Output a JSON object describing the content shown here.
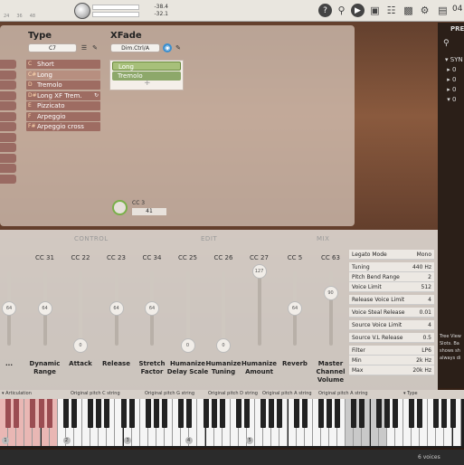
{
  "toolbar": {
    "meter_ticks": [
      "24",
      "36",
      "48"
    ],
    "db_top": "-38.4",
    "db_bottom": "-32.1",
    "icons": [
      "help-icon",
      "location-icon",
      "play-icon",
      "stop-icon",
      "keyboard-icon",
      "chip-icon",
      "gear-icon",
      "folder-icon"
    ],
    "folder_number": "04"
  },
  "type": {
    "title": "Type",
    "selector": "C7",
    "items": [
      {
        "key": "C",
        "label": "Short"
      },
      {
        "key": "C#",
        "label": "Long"
      },
      {
        "key": "D",
        "label": "Tremolo"
      },
      {
        "key": "D#",
        "label": "Long XF Trem."
      },
      {
        "key": "E",
        "label": "Pizzicato"
      },
      {
        "key": "F",
        "label": "Arpeggio"
      },
      {
        "key": "F#",
        "label": "Arpeggio cross"
      }
    ]
  },
  "xfade": {
    "title": "XFade",
    "selector": "Dim.Ctrl/A",
    "items": [
      "Long",
      "Tremolo"
    ]
  },
  "cc3": {
    "label": "CC 3",
    "value": "41"
  },
  "sections": {
    "control": "CONTROL",
    "edit": "EDIT",
    "mix": "MIX"
  },
  "sliders": [
    {
      "cc": "",
      "name": "...",
      "value": 64,
      "label": "64"
    },
    {
      "cc": "CC 31",
      "name": "Dynamic Range",
      "value": 64,
      "label": "64"
    },
    {
      "cc": "CC 22",
      "name": "Attack",
      "value": 0,
      "label": "0"
    },
    {
      "cc": "CC 23",
      "name": "Release",
      "value": 64,
      "label": "64"
    },
    {
      "cc": "CC 34",
      "name": "Stretch Factor",
      "value": 64,
      "label": "64"
    },
    {
      "cc": "CC 25",
      "name": "Humanize Delay Scale",
      "value": 0,
      "label": "0"
    },
    {
      "cc": "CC 26",
      "name": "Humanize Tuning",
      "value": 0,
      "label": "0"
    },
    {
      "cc": "CC 27",
      "name": "Humanize Amount",
      "value": 127,
      "label": "127"
    },
    {
      "cc": "CC 5",
      "name": "Reverb",
      "value": 64,
      "label": "64"
    },
    {
      "cc": "CC 63",
      "name": "Master Channel Volume",
      "value": 90,
      "label": "90"
    }
  ],
  "params": [
    {
      "k": "Legato Mode",
      "v": "Mono"
    },
    {
      "k": "Tuning",
      "v": "440 Hz"
    },
    {
      "k": "Pitch Bend Range",
      "v": "2"
    },
    {
      "k": "Voice Limit",
      "v": "512"
    },
    {
      "k": "Release Voice Limit",
      "v": "4"
    },
    {
      "k": "Voice Steal Release",
      "v": "0.01"
    },
    {
      "k": "Source Voice Limit",
      "v": "4"
    },
    {
      "k": "Source V.L Release",
      "v": "0.5"
    },
    {
      "k": "Filter",
      "v": "LP6"
    },
    {
      "k": "Min",
      "v": "2k Hz"
    },
    {
      "k": "Max",
      "v": "20k Hz"
    }
  ],
  "presets": {
    "title": "PRE",
    "tree": [
      "SYN",
      "0",
      "0",
      "0",
      "0"
    ],
    "tip": "Tree View Slots. Ba shows sh always di"
  },
  "keyboard": {
    "articulation_label": "Articulation",
    "type_label": "Type",
    "strings": [
      "Original pitch C string",
      "Original pitch G string",
      "Original pitch D string",
      "Original pitch A string",
      "Original pitch A string"
    ],
    "octaves": [
      "1",
      "2",
      "3",
      "4",
      "5"
    ]
  },
  "status": {
    "voices": "6 voices"
  }
}
